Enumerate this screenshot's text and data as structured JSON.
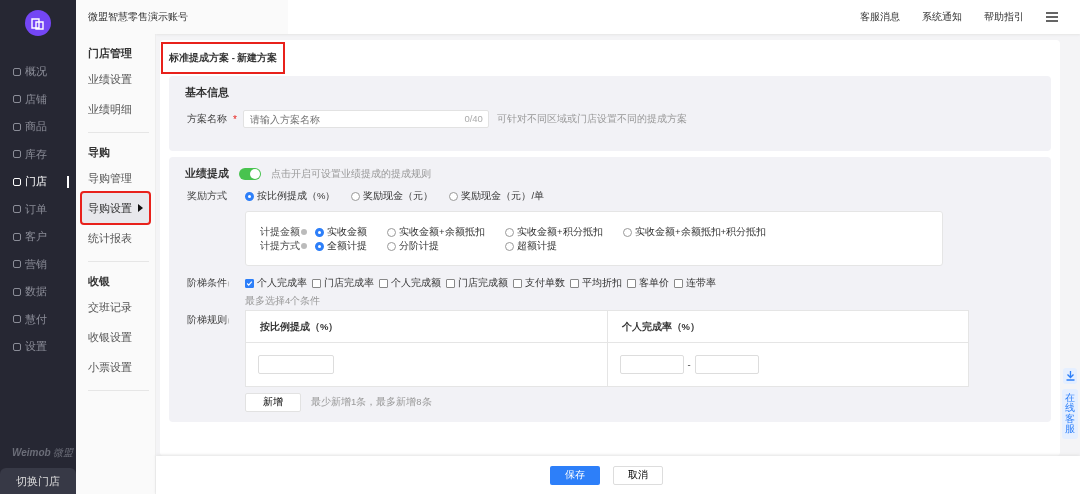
{
  "nav": {
    "items": [
      {
        "label": "概况",
        "selected": false
      },
      {
        "label": "店铺",
        "selected": false
      },
      {
        "label": "商品",
        "selected": false
      },
      {
        "label": "库存",
        "selected": false
      },
      {
        "label": "门店",
        "selected": true
      },
      {
        "label": "订单",
        "selected": false
      },
      {
        "label": "客户",
        "selected": false
      },
      {
        "label": "营销",
        "selected": false
      },
      {
        "label": "数据",
        "selected": false
      },
      {
        "label": "慧付",
        "selected": false
      },
      {
        "label": "设置",
        "selected": false
      }
    ],
    "brand": "Weimob",
    "brand_sub": "微盟",
    "switch_button": "切换门店"
  },
  "subnav": {
    "groups": [
      {
        "title": "门店管理",
        "items": [
          {
            "label": "业绩设置",
            "selected": false,
            "highlighted": false
          },
          {
            "label": "业绩明细",
            "selected": false,
            "highlighted": false
          }
        ]
      },
      {
        "title": "导购",
        "items": [
          {
            "label": "导购管理",
            "selected": false,
            "highlighted": false
          },
          {
            "label": "导购设置",
            "selected": true,
            "highlighted": true
          },
          {
            "label": "统计报表",
            "selected": false,
            "highlighted": false
          }
        ]
      },
      {
        "title": "收银",
        "items": [
          {
            "label": "交班记录",
            "selected": false,
            "highlighted": false
          },
          {
            "label": "收银设置",
            "selected": false,
            "highlighted": false
          },
          {
            "label": "小票设置",
            "selected": false,
            "highlighted": false
          }
        ]
      }
    ]
  },
  "header": {
    "account": "微盟智慧零售演示账号",
    "links": [
      "客服消息",
      "系统通知",
      "帮助指引"
    ]
  },
  "page_title": {
    "text": "标准提成方案 - 新建方案",
    "highlighted": true
  },
  "basic_info": {
    "title": "基本信息",
    "field_label": "方案名称",
    "required_mark": "*",
    "placeholder": "请输入方案名称",
    "counter": "0/40",
    "hint": "可针对不同区域或门店设置不同的提成方案"
  },
  "commission": {
    "title": "业绩提成",
    "toggle_on": true,
    "toggle_hint": "点击开启可设置业绩提成的提成规则",
    "reward_mode": {
      "label": "奖励方式",
      "options": [
        {
          "label": "按比例提成（%）",
          "selected": true
        },
        {
          "label": "奖励现金（元）",
          "selected": false
        },
        {
          "label": "奖励现金（元）/单",
          "selected": false
        }
      ]
    },
    "calc_amount": {
      "label": "计提金额",
      "options": [
        {
          "label": "实收金额",
          "selected": true
        },
        {
          "label": "实收金额+余额抵扣",
          "selected": false
        },
        {
          "label": "实收金额+积分抵扣",
          "selected": false
        },
        {
          "label": "实收金额+余额抵扣+积分抵扣",
          "selected": false
        }
      ]
    },
    "calc_method": {
      "label": "计提方式",
      "options": [
        {
          "label": "全额计提",
          "selected": true
        },
        {
          "label": "分阶计提",
          "selected": false
        },
        {
          "label": "超额计提",
          "selected": false
        }
      ]
    },
    "tier_conditions": {
      "label": "阶梯条件",
      "options": [
        {
          "label": "个人完成率",
          "checked": true
        },
        {
          "label": "门店完成率",
          "checked": false
        },
        {
          "label": "个人完成额",
          "checked": false
        },
        {
          "label": "门店完成额",
          "checked": false
        },
        {
          "label": "支付单数",
          "checked": false
        },
        {
          "label": "平均折扣",
          "checked": false
        },
        {
          "label": "客单价",
          "checked": false
        },
        {
          "label": "连带率",
          "checked": false
        }
      ],
      "hint": "最多选择4个条件"
    },
    "tier_rules": {
      "label": "阶梯规则",
      "columns": [
        "按比例提成（%）",
        "个人完成率（%）"
      ],
      "range_separator": "-"
    },
    "add_button": "新增",
    "add_hint": "最少新增1条，最多新增8条"
  },
  "footer": {
    "save": "保存",
    "cancel": "取消"
  },
  "side_widget": {
    "label": "在线客服"
  }
}
